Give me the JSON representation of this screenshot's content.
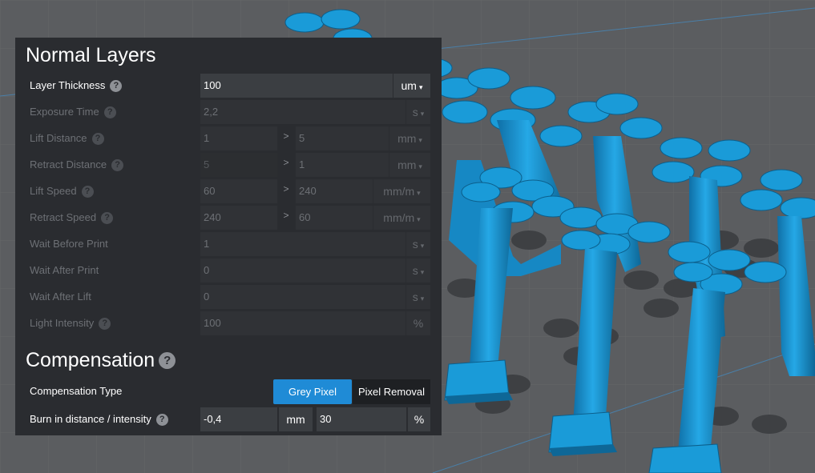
{
  "normal_layers": {
    "title": "Normal Layers",
    "layer_thickness": {
      "label": "Layer Thickness",
      "value": "100",
      "unit": "um"
    },
    "exposure_time": {
      "label": "Exposure Time",
      "value": "2,2",
      "unit": "s"
    },
    "lift_distance": {
      "label": "Lift Distance",
      "value1": "1",
      "sep": ">",
      "value2": "5",
      "unit": "mm"
    },
    "retract_distance": {
      "label": "Retract Distance",
      "value1": "5",
      "sep": ">",
      "value2": "1",
      "unit": "mm"
    },
    "lift_speed": {
      "label": "Lift Speed",
      "value1": "60",
      "sep": ">",
      "value2": "240",
      "unit": "mm/m"
    },
    "retract_speed": {
      "label": "Retract Speed",
      "value1": "240",
      "sep": ">",
      "value2": "60",
      "unit": "mm/m"
    },
    "wait_before_print": {
      "label": "Wait Before Print",
      "value": "1",
      "unit": "s"
    },
    "wait_after_print": {
      "label": "Wait After Print",
      "value": "0",
      "unit": "s"
    },
    "wait_after_lift": {
      "label": "Wait After Lift",
      "value": "0",
      "unit": "s"
    },
    "light_intensity": {
      "label": "Light Intensity",
      "value": "100",
      "unit": "%"
    }
  },
  "compensation": {
    "title": "Compensation",
    "type_label": "Compensation Type",
    "options": [
      "Grey Pixel",
      "Pixel Removal"
    ],
    "selected": "Grey Pixel",
    "burn": {
      "label": "Burn in distance / intensity",
      "distance": "-0,4",
      "distance_unit": "mm",
      "intensity": "30",
      "intensity_unit": "%"
    }
  },
  "icons": {
    "help": "?",
    "caret": "▾"
  },
  "colors": {
    "accent": "#1f8bd6",
    "model": "#1a9bd8",
    "panel": "#2a2c30"
  }
}
